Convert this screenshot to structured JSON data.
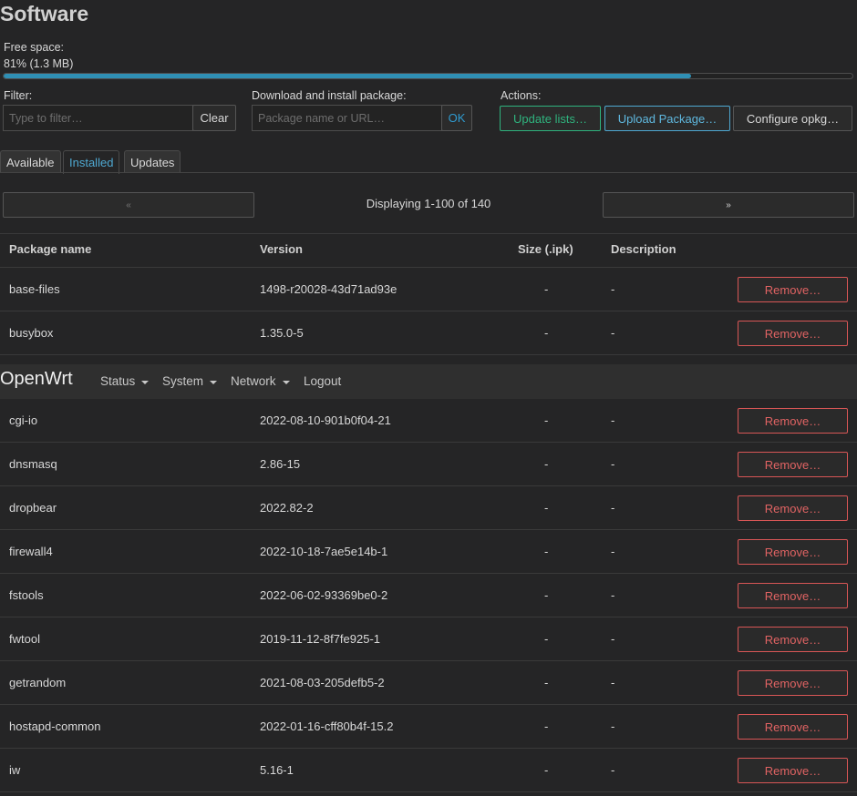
{
  "page_title": "Software",
  "free_space": {
    "label": "Free space:",
    "value": "81% (1.3 MB)",
    "percent": 81
  },
  "filter": {
    "label": "Filter:",
    "placeholder": "Type to filter…",
    "clear_label": "Clear"
  },
  "download": {
    "label": "Download and install package:",
    "placeholder": "Package name or URL…",
    "ok_label": "OK"
  },
  "actions": {
    "label": "Actions:",
    "update_lists": "Update lists…",
    "upload_package": "Upload Package…",
    "configure_opkg": "Configure opkg…"
  },
  "tabs": [
    {
      "label": "Available"
    },
    {
      "label": "Installed",
      "active": true
    },
    {
      "label": "Updates"
    }
  ],
  "pager": {
    "prev": "«",
    "next": "»",
    "text": "Displaying 1-100 of 140"
  },
  "table": {
    "headers": [
      "Package name",
      "Version",
      "Size (.ipk)",
      "Description"
    ],
    "remove_label": "Remove…",
    "rows_top": [
      {
        "name": "base-files",
        "version": "1498-r20028-43d71ad93e",
        "size": "-",
        "description": "-"
      },
      {
        "name": "busybox",
        "version": "1.35.0-5",
        "size": "-",
        "description": "-"
      }
    ],
    "rows_bottom": [
      {
        "name": "cgi-io",
        "version": "2022-08-10-901b0f04-21",
        "size": "-",
        "description": "-"
      },
      {
        "name": "dnsmasq",
        "version": "2.86-15",
        "size": "-",
        "description": "-"
      },
      {
        "name": "dropbear",
        "version": "2022.82-2",
        "size": "-",
        "description": "-"
      },
      {
        "name": "firewall4",
        "version": "2022-10-18-7ae5e14b-1",
        "size": "-",
        "description": "-"
      },
      {
        "name": "fstools",
        "version": "2022-06-02-93369be0-2",
        "size": "-",
        "description": "-"
      },
      {
        "name": "fwtool",
        "version": "2019-11-12-8f7fe925-1",
        "size": "-",
        "description": "-"
      },
      {
        "name": "getrandom",
        "version": "2021-08-03-205defb5-2",
        "size": "-",
        "description": "-"
      },
      {
        "name": "hostapd-common",
        "version": "2022-01-16-cff80b4f-15.2",
        "size": "-",
        "description": "-"
      },
      {
        "name": "iw",
        "version": "5.16-1",
        "size": "-",
        "description": "-"
      }
    ]
  },
  "navbar": {
    "brand": "OpenWrt",
    "items": [
      {
        "label": "Status",
        "dropdown": true
      },
      {
        "label": "System",
        "dropdown": true
      },
      {
        "label": "Network",
        "dropdown": true
      },
      {
        "label": "Logout",
        "dropdown": false
      }
    ]
  },
  "colors": {
    "accent": "#2f8fb4",
    "danger": "#e06363",
    "success": "#2fb37e"
  }
}
